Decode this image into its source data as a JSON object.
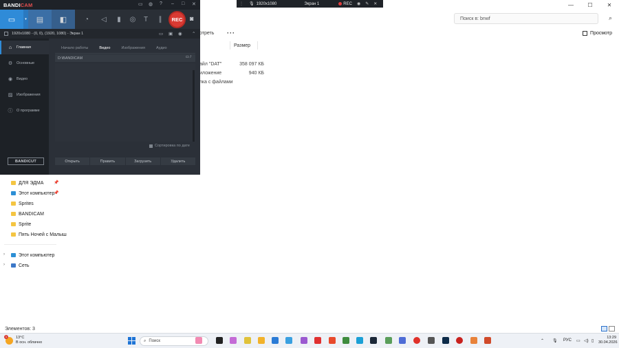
{
  "explorer": {
    "search_placeholder": "Поиск в: bnwf",
    "toolbar": {
      "sort_label": "отреть",
      "preview_label": "Просмотр"
    },
    "columns": {
      "size": "Размер"
    },
    "rows": [
      {
        "name": "айл \"DAT\"",
        "size": "358 097 КБ"
      },
      {
        "name": "иложение",
        "size": "940 КБ"
      },
      {
        "name": "пка с файлами",
        "size": ""
      }
    ],
    "nav": {
      "quick": [
        {
          "label": "ДЛЯ ЭДМА",
          "icon": "folder-icon",
          "pinned": true
        },
        {
          "label": "Этот компьютер",
          "icon": "pc-icon",
          "pinned": true
        },
        {
          "label": "Sprites",
          "icon": "folder-icon",
          "pinned": false
        },
        {
          "label": "BANDICAM",
          "icon": "folder-icon",
          "pinned": false
        },
        {
          "label": "Sprite",
          "icon": "folder-icon",
          "pinned": false
        },
        {
          "label": "Пять Ночей с Малыш",
          "icon": "folder-icon",
          "pinned": false
        }
      ],
      "tree": [
        {
          "label": "Этот компьютер",
          "icon": "pc-icon"
        },
        {
          "label": "Сеть",
          "icon": "network-icon"
        }
      ]
    },
    "status": "Элементов: 3"
  },
  "recbar": {
    "resolution": "1920x1080",
    "screen": "Экран 1",
    "rec_label": "REC"
  },
  "bandicam": {
    "logo": {
      "a": "BANDI",
      "b": "CAM"
    },
    "rec_label": "REC",
    "subbar": "1920x1080 - (0, 0), (1920, 1080) - Экран 1",
    "sidebar": [
      {
        "label": "Главная",
        "icon": "home-icon",
        "active": true
      },
      {
        "label": "Основные",
        "icon": "gear-icon",
        "active": false
      },
      {
        "label": "Видео",
        "icon": "video-icon",
        "active": false
      },
      {
        "label": "Изображения",
        "icon": "image-icon",
        "active": false
      },
      {
        "label": "О программе",
        "icon": "info-icon",
        "active": false
      }
    ],
    "bandicut_label": "BANDICUT",
    "tabs": [
      {
        "label": "Начало работы",
        "active": false
      },
      {
        "label": "Видео",
        "active": true
      },
      {
        "label": "Изображения",
        "active": false
      },
      {
        "label": "Аудио",
        "active": false
      }
    ],
    "path": "D:\\BANDICAM",
    "sort_label": "Сортировка по дате",
    "actions": [
      "Открыть",
      "Править",
      "Загрузить",
      "Удалить"
    ]
  },
  "taskbar": {
    "weather": {
      "temp": "13°C",
      "desc": "В осн. облачно",
      "badge": "1"
    },
    "search_label": "Поиск",
    "lang": "РУС",
    "time": "13:29",
    "date": "30.04.2026"
  },
  "colors": {
    "accent": "#2f8bd8",
    "rec": "#d93a33",
    "bandicam_bg": "#2b3038"
  }
}
